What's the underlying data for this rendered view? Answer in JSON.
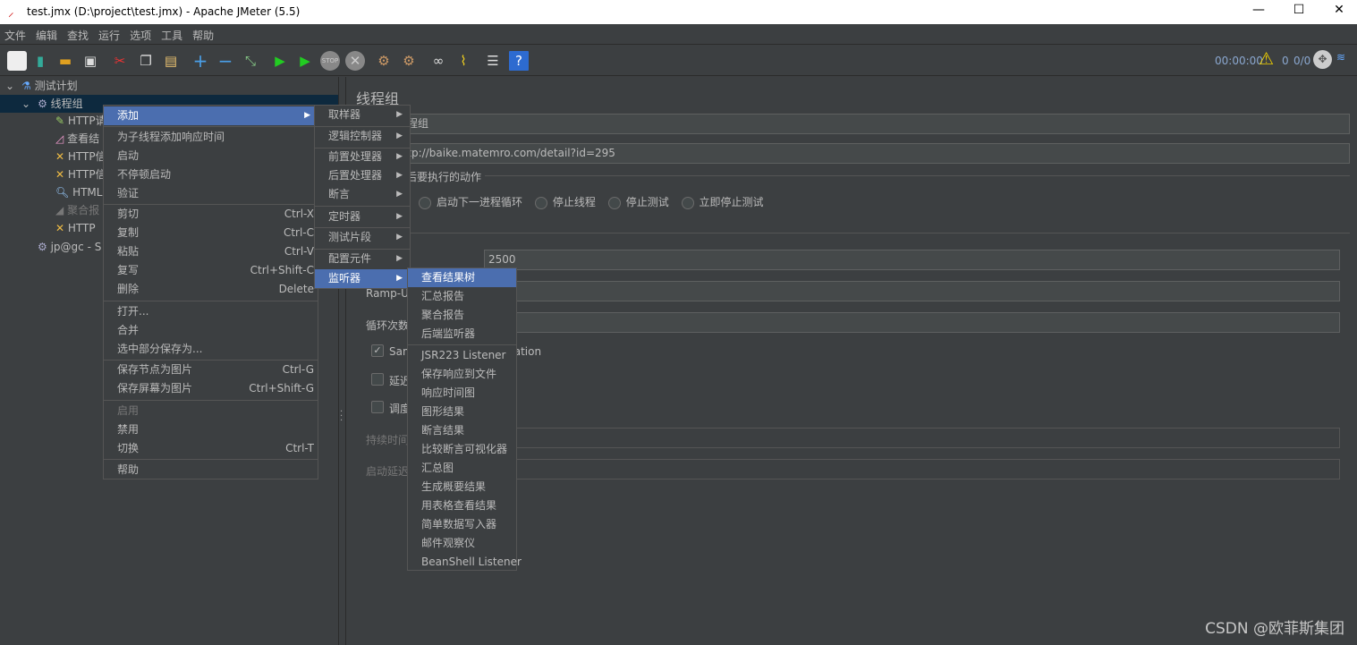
{
  "window": {
    "title": "test.jmx (D:\\project\\test.jmx) - Apache JMeter (5.5)",
    "minimize": "—",
    "maximize": "☐",
    "close": "✕"
  },
  "menubar": [
    "文件",
    "编辑",
    "查找",
    "运行",
    "选项",
    "工具",
    "帮助"
  ],
  "toolbar": {
    "icons": [
      "new-icon",
      "templates-icon",
      "open-icon",
      "save-icon",
      "cut-icon",
      "copy-icon",
      "paste-icon",
      "expand-icon",
      "collapse-icon",
      "toggle-icon",
      "start-icon",
      "start-no-pause-icon",
      "stop-icon",
      "shutdown-icon",
      "clear-icon",
      "clear-all-icon",
      "search-icon",
      "reset-search-icon",
      "function-helper-icon",
      "help-icon"
    ],
    "timer": "00:00:00",
    "warnings": "0",
    "threads": "0/0"
  },
  "tree": [
    {
      "label": "测试计划",
      "icon": "flask-icon"
    },
    {
      "label": "线程组",
      "icon": "gear-icon"
    },
    {
      "label": "HTTP请",
      "icon": "pipette-icon"
    },
    {
      "label": "查看结",
      "icon": "graph-icon"
    },
    {
      "label": "HTTP信",
      "icon": "wrench-icon"
    },
    {
      "label": "HTTP信",
      "icon": "wrench-icon"
    },
    {
      "label": "HTML",
      "icon": "magnifier-icon"
    },
    {
      "label": "聚合报",
      "icon": "chart-icon"
    },
    {
      "label": "HTTP",
      "icon": "wrench-icon"
    },
    {
      "label": "jp@gc - S",
      "icon": "gear-icon"
    }
  ],
  "panel": {
    "title": "线程组",
    "name_value": "线程组",
    "comment_value": "http://baike.matemro.com/detail?id=295",
    "error_action_label": "在取样器错误后要执行的动作",
    "radios": [
      "启动下一进程循环",
      "停止线程",
      "停止测试",
      "立即停止测试"
    ],
    "threads_value": "2500",
    "rampup_label": "Ramp-Up时间(秒)：",
    "loop_label": "循环次数",
    "same_user_label": "Same user on each iteration",
    "same_user_checked": true,
    "delay_label": "延迟创建线程直到需要",
    "scheduler_label": "调度器",
    "duration_label": "持续时间（秒）",
    "startup_delay_label": "启动延迟（秒）"
  },
  "context_menu": {
    "add": "添加",
    "add_think": "为子线程添加响应时间",
    "start": "启动",
    "start_no_pause": "不停顿启动",
    "validate": "验证",
    "cut": "剪切",
    "cut_sc": "Ctrl-X",
    "copy": "复制",
    "copy_sc": "Ctrl-C",
    "paste": "粘贴",
    "paste_sc": "Ctrl-V",
    "duplicate": "复写",
    "duplicate_sc": "Ctrl+Shift-C",
    "delete": "删除",
    "delete_sc": "Delete",
    "open": "打开...",
    "merge": "合并",
    "save_selection": "选中部分保存为...",
    "save_node_img": "保存节点为图片",
    "save_node_img_sc": "Ctrl-G",
    "save_screen_img": "保存屏幕为图片",
    "save_screen_img_sc": "Ctrl+Shift-G",
    "enable": "启用",
    "disable": "禁用",
    "toggle": "切换",
    "toggle_sc": "Ctrl-T",
    "help": "帮助"
  },
  "add_submenu": [
    "取样器",
    "逻辑控制器",
    "前置处理器",
    "后置处理器",
    "断言",
    "定时器",
    "测试片段",
    "配置元件",
    "监听器"
  ],
  "listener_submenu": [
    "查看结果树",
    "汇总报告",
    "聚合报告",
    "后端监听器",
    "JSR223 Listener",
    "保存响应到文件",
    "响应时间图",
    "图形结果",
    "断言结果",
    "比较断言可视化器",
    "汇总图",
    "生成概要结果",
    "用表格查看结果",
    "简单数据写入器",
    "邮件观察仪",
    "BeanShell Listener"
  ],
  "watermark": "CSDN @欧菲斯集团"
}
